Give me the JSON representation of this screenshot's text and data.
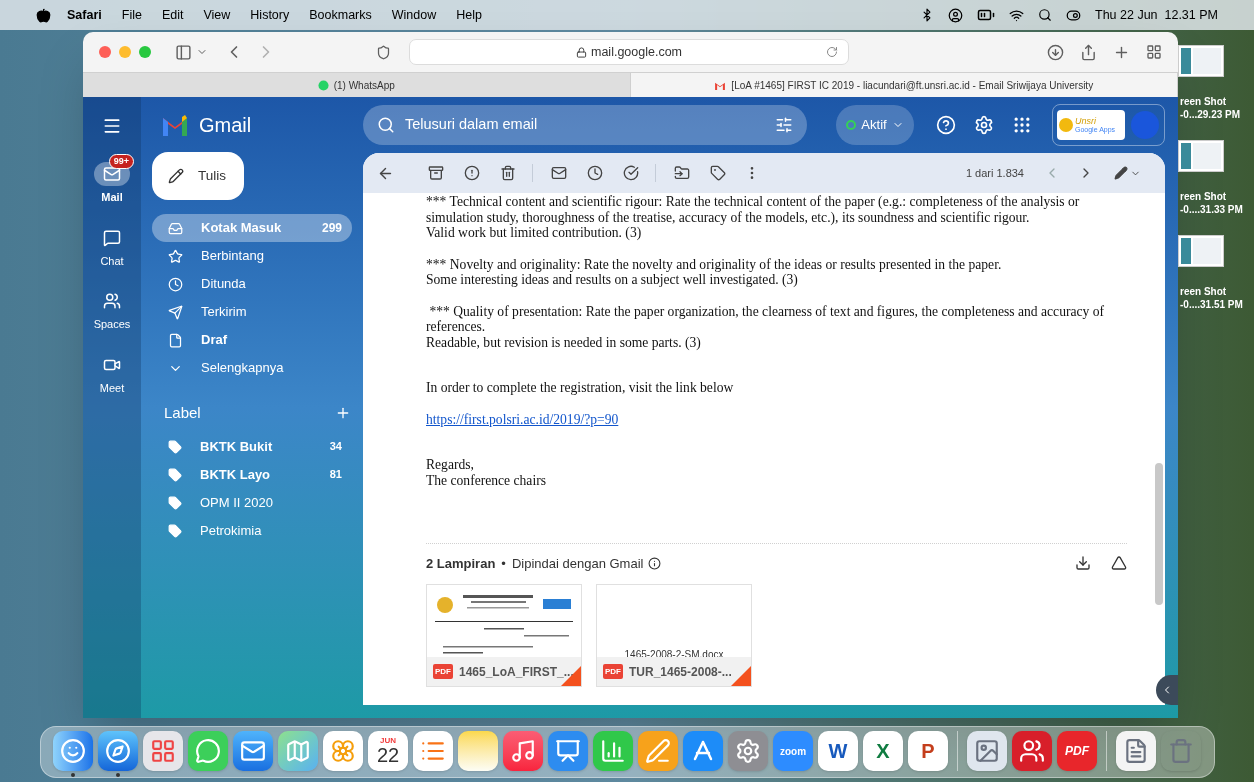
{
  "menu_bar": {
    "app": "Safari",
    "menus": [
      "File",
      "Edit",
      "View",
      "History",
      "Bookmarks",
      "Window",
      "Help"
    ],
    "clock": "Thu 22 Jun  12.31 PM"
  },
  "browser": {
    "address": "mail.google.com",
    "tabs": [
      {
        "title": "(1) WhatsApp",
        "kind": "whatsapp",
        "selected": false
      },
      {
        "title": "[LoA #1465] FIRST IC 2019 - liacundari@ft.unsri.ac.id - Email Sriwijaya University",
        "kind": "gmail",
        "selected": true
      }
    ]
  },
  "gmail": {
    "product": "Gmail",
    "rail": [
      {
        "label": "Mail",
        "kind": "mail",
        "selected": true,
        "badge": "99+"
      },
      {
        "label": "Chat",
        "kind": "chat",
        "selected": false
      },
      {
        "label": "Spaces",
        "kind": "spaces",
        "selected": false
      },
      {
        "label": "Meet",
        "kind": "meet",
        "selected": false
      }
    ],
    "compose": "Tulis",
    "folders": [
      {
        "label": "Kotak Masuk",
        "kind": "inbox",
        "count": "299",
        "selected": true,
        "bold": true
      },
      {
        "label": "Berbintang",
        "kind": "starred",
        "selected": false,
        "bold": false
      },
      {
        "label": "Ditunda",
        "kind": "snoozed",
        "selected": false,
        "bold": false
      },
      {
        "label": "Terkirim",
        "kind": "sent",
        "selected": false,
        "bold": false
      },
      {
        "label": "Draf",
        "kind": "drafts",
        "selected": false,
        "bold": true
      },
      {
        "label": "Selengkapnya",
        "kind": "more",
        "selected": false,
        "bold": false
      }
    ],
    "labels_heading": "Label",
    "labels": [
      {
        "name": "BKTK Bukit",
        "count": "34",
        "bold": true
      },
      {
        "name": "BKTK Layo",
        "count": "81",
        "bold": true
      },
      {
        "name": "OPM II 2020",
        "bold": false
      },
      {
        "name": "Petrokimia",
        "bold": false
      }
    ],
    "search": {
      "placeholder": "Telusuri dalam email"
    },
    "status": "Aktif",
    "account_logo": [
      "Unsri",
      "Google Apps"
    ],
    "pager": "1 dari 1.834",
    "message": [
      {
        "kind": "text",
        "lines": [
          "*** Technical content and scientific rigour: Rate the technical content of the paper (e.g.: completeness of the analysis or simulation study, thoroughness of the treatise, accuracy of the models, etc.), its soundness and scientific rigour.",
          "Valid work but limited contribution. (3)"
        ]
      },
      {
        "kind": "text",
        "lines": [
          "*** Novelty and originality: Rate the novelty and originality of the ideas or results presented in the paper.",
          "Some interesting ideas and results on a subject well investigated. (3)"
        ]
      },
      {
        "kind": "text",
        "lines": [
          " *** Quality of presentation: Rate the paper organization, the clearness of text and figures, the completeness and accuracy of references.",
          "Readable, but revision is needed in some parts. (3)"
        ]
      },
      {
        "kind": "text",
        "lines": [
          "In order to complete the registration, visit the link below"
        ]
      },
      {
        "kind": "link",
        "lines": [
          "https://first.polsri.ac.id/2019/?p=90"
        ]
      },
      {
        "kind": "text",
        "lines": [
          "Regards,",
          "The conference chairs"
        ]
      }
    ],
    "attachments": {
      "title": "2 Lampiran",
      "separator": "•",
      "note": "Dipindai dengan Gmail",
      "files": [
        {
          "kind": "letter",
          "name": "1465_LoA_FIRST_...",
          "badge": "PDF"
        },
        {
          "kind": "docx",
          "name": "TUR_1465-2008-...",
          "preview": "1465-2008-2-SM.docx",
          "badge": "PDF"
        }
      ]
    }
  },
  "desktop_files": [
    {
      "lines": [
        "reen Shot",
        "-0...29.23 PM"
      ]
    },
    {
      "lines": [
        "reen Shot",
        "-0....31.33 PM"
      ]
    },
    {
      "lines": [
        "reen Shot",
        "-0....31.51 PM"
      ]
    }
  ],
  "dock": [
    {
      "kind": "finder",
      "running": true
    },
    {
      "kind": "safari",
      "running": true
    },
    {
      "kind": "launchpad",
      "running": false
    },
    {
      "kind": "messages",
      "running": false
    },
    {
      "kind": "mail",
      "running": false
    },
    {
      "kind": "maps",
      "running": false
    },
    {
      "kind": "photos",
      "running": false
    },
    {
      "kind": "calendar",
      "running": false,
      "labels": [
        "JUN",
        "22"
      ]
    },
    {
      "kind": "reminders",
      "running": false
    },
    {
      "kind": "notes",
      "running": false
    },
    {
      "kind": "music",
      "running": false
    },
    {
      "kind": "keynote",
      "running": false
    },
    {
      "kind": "numbers",
      "running": false
    },
    {
      "kind": "pages",
      "running": false
    },
    {
      "kind": "appstore",
      "running": false
    },
    {
      "kind": "settings",
      "running": false
    },
    {
      "kind": "zoom",
      "running": false,
      "labels": [
        "zoom"
      ]
    },
    {
      "kind": "word",
      "running": false,
      "labels": [
        "W"
      ]
    },
    {
      "kind": "excel",
      "running": false,
      "labels": [
        "X"
      ]
    },
    {
      "kind": "powerpoint",
      "running": false,
      "labels": [
        "P"
      ]
    },
    {
      "kind": "divider"
    },
    {
      "kind": "preview",
      "running": false
    },
    {
      "kind": "mendeley",
      "running": false
    },
    {
      "kind": "pdf",
      "running": false,
      "labels": [
        "PDF"
      ]
    },
    {
      "kind": "divider"
    },
    {
      "kind": "document",
      "running": false
    },
    {
      "kind": "trash",
      "running": false
    }
  ]
}
